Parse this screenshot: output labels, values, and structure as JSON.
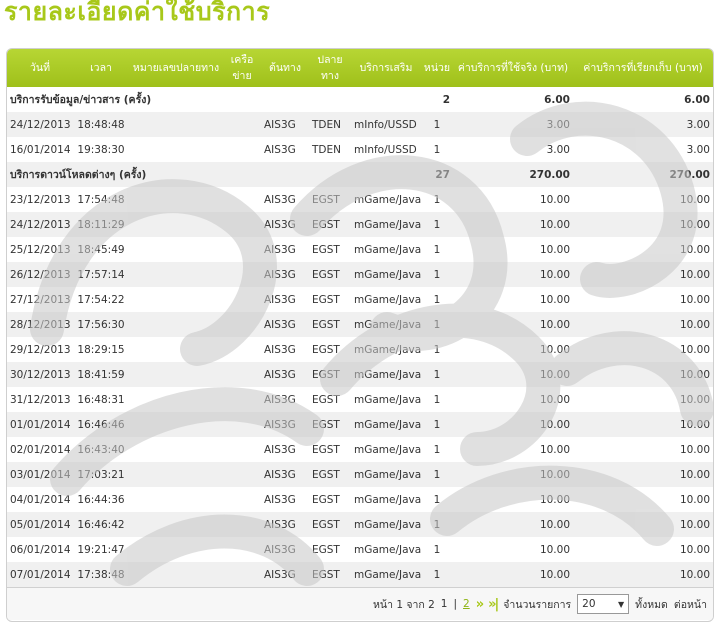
{
  "page": {
    "title": "รายละเอียดค่าใช้บริการ"
  },
  "table": {
    "headers": [
      "วันที่",
      "เวลา",
      "หมายเลขปลายทาง",
      "เครือข่าย",
      "ต้นทาง",
      "ปลายทาง",
      "บริการเสริม",
      "หน่วย",
      "ค่าบริการที่ใช้จริง (บาท)",
      "ค่าบริการที่เรียกเก็บ (บาท)"
    ],
    "rows": [
      {
        "group": true,
        "label": "บริการรับข้อมูล/ข่าวสาร (ครั้ง)",
        "units": "2",
        "actual": "6.00",
        "billed": "6.00"
      },
      {
        "date": "24/12/2013",
        "time": "18:48:48",
        "dest": "",
        "network": "",
        "origin": "AIS3G",
        "destination": "TDEN",
        "service": "mInfo/USSD",
        "units": "1",
        "actual": "3.00",
        "billed": "3.00"
      },
      {
        "date": "16/01/2014",
        "time": "19:38:30",
        "dest": "",
        "network": "",
        "origin": "AIS3G",
        "destination": "TDEN",
        "service": "mInfo/USSD",
        "units": "1",
        "actual": "3.00",
        "billed": "3.00"
      },
      {
        "group": true,
        "label": "บริการดาวน์โหลดต่างๆ (ครั้ง)",
        "units": "27",
        "actual": "270.00",
        "billed": "270.00"
      },
      {
        "date": "23/12/2013",
        "time": "17:54:48",
        "dest": "",
        "network": "",
        "origin": "AIS3G",
        "destination": "EGST",
        "service": "mGame/Java",
        "units": "1",
        "actual": "10.00",
        "billed": "10.00"
      },
      {
        "date": "24/12/2013",
        "time": "18:11:29",
        "dest": "",
        "network": "",
        "origin": "AIS3G",
        "destination": "EGST",
        "service": "mGame/Java",
        "units": "1",
        "actual": "10.00",
        "billed": "10.00"
      },
      {
        "date": "25/12/2013",
        "time": "18:45:49",
        "dest": "",
        "network": "",
        "origin": "AIS3G",
        "destination": "EGST",
        "service": "mGame/Java",
        "units": "1",
        "actual": "10.00",
        "billed": "10.00"
      },
      {
        "date": "26/12/2013",
        "time": "17:57:14",
        "dest": "",
        "network": "",
        "origin": "AIS3G",
        "destination": "EGST",
        "service": "mGame/Java",
        "units": "1",
        "actual": "10.00",
        "billed": "10.00"
      },
      {
        "date": "27/12/2013",
        "time": "17:54:22",
        "dest": "",
        "network": "",
        "origin": "AIS3G",
        "destination": "EGST",
        "service": "mGame/Java",
        "units": "1",
        "actual": "10.00",
        "billed": "10.00"
      },
      {
        "date": "28/12/2013",
        "time": "17:56:30",
        "dest": "",
        "network": "",
        "origin": "AIS3G",
        "destination": "EGST",
        "service": "mGame/Java",
        "units": "1",
        "actual": "10.00",
        "billed": "10.00"
      },
      {
        "date": "29/12/2013",
        "time": "18:29:15",
        "dest": "",
        "network": "",
        "origin": "AIS3G",
        "destination": "EGST",
        "service": "mGame/Java",
        "units": "1",
        "actual": "10.00",
        "billed": "10.00"
      },
      {
        "date": "30/12/2013",
        "time": "18:41:59",
        "dest": "",
        "network": "",
        "origin": "AIS3G",
        "destination": "EGST",
        "service": "mGame/Java",
        "units": "1",
        "actual": "10.00",
        "billed": "10.00"
      },
      {
        "date": "31/12/2013",
        "time": "16:48:31",
        "dest": "",
        "network": "",
        "origin": "AIS3G",
        "destination": "EGST",
        "service": "mGame/Java",
        "units": "1",
        "actual": "10.00",
        "billed": "10.00"
      },
      {
        "date": "01/01/2014",
        "time": "16:46:46",
        "dest": "",
        "network": "",
        "origin": "AIS3G",
        "destination": "EGST",
        "service": "mGame/Java",
        "units": "1",
        "actual": "10.00",
        "billed": "10.00"
      },
      {
        "date": "02/01/2014",
        "time": "16:43:40",
        "dest": "",
        "network": "",
        "origin": "AIS3G",
        "destination": "EGST",
        "service": "mGame/Java",
        "units": "1",
        "actual": "10.00",
        "billed": "10.00"
      },
      {
        "date": "03/01/2014",
        "time": "17:03:21",
        "dest": "",
        "network": "",
        "origin": "AIS3G",
        "destination": "EGST",
        "service": "mGame/Java",
        "units": "1",
        "actual": "10.00",
        "billed": "10.00"
      },
      {
        "date": "04/01/2014",
        "time": "16:44:36",
        "dest": "",
        "network": "",
        "origin": "AIS3G",
        "destination": "EGST",
        "service": "mGame/Java",
        "units": "1",
        "actual": "10.00",
        "billed": "10.00"
      },
      {
        "date": "05/01/2014",
        "time": "16:46:42",
        "dest": "",
        "network": "",
        "origin": "AIS3G",
        "destination": "EGST",
        "service": "mGame/Java",
        "units": "1",
        "actual": "10.00",
        "billed": "10.00"
      },
      {
        "date": "06/01/2014",
        "time": "19:21:47",
        "dest": "",
        "network": "",
        "origin": "AIS3G",
        "destination": "EGST",
        "service": "mGame/Java",
        "units": "1",
        "actual": "10.00",
        "billed": "10.00"
      },
      {
        "date": "07/01/2014",
        "time": "17:38:48",
        "dest": "",
        "network": "",
        "origin": "AIS3G",
        "destination": "EGST",
        "service": "mGame/Java",
        "units": "1",
        "actual": "10.00",
        "billed": "10.00"
      }
    ]
  },
  "pager": {
    "page_info": "หน้า 1 จาก 2",
    "page_1": "1",
    "separator": "|",
    "page_2": "2",
    "next_arrow": "»",
    "last_arrow": "»|",
    "per_page_label": "จำนวนรายการ",
    "per_page_value": "20",
    "show_all": "ทั้งหมด",
    "next_label": "ต่อหน้า"
  },
  "colors": {
    "accent": "#a8c81a",
    "header": "#9fc01a",
    "stripe": "#f0f0f0",
    "watermark": "#c8c8c8"
  },
  "watermark": {
    "icon": "sample-watermark-icon"
  }
}
